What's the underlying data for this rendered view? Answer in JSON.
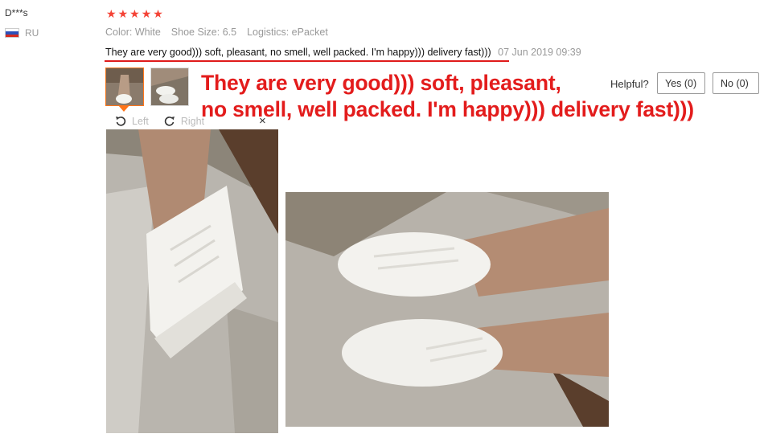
{
  "reviewer": {
    "name": "D***s",
    "country": "RU"
  },
  "rating": {
    "stars": 5,
    "max": 5
  },
  "attributes": {
    "color": "Color: White",
    "size": "Shoe Size: 6.5",
    "logistics": "Logistics: ePacket"
  },
  "review": {
    "text": "They are very good))) soft, pleasant, no smell, well packed. I'm happy))) delivery fast)))",
    "date": "07 Jun 2019 09:39"
  },
  "overlay": {
    "line1": "They are very good))) soft, pleasant,",
    "line2": "no smell, well packed. I'm happy))) delivery fast)))"
  },
  "helpful": {
    "label": "Helpful?",
    "yes": "Yes (0)",
    "no": "No (0)"
  },
  "viewer": {
    "left": "Left",
    "right": "Right",
    "close": "×"
  },
  "colors": {
    "star": "#f44336",
    "accent": "#ff7519",
    "overlay_text": "#e31c1c"
  }
}
